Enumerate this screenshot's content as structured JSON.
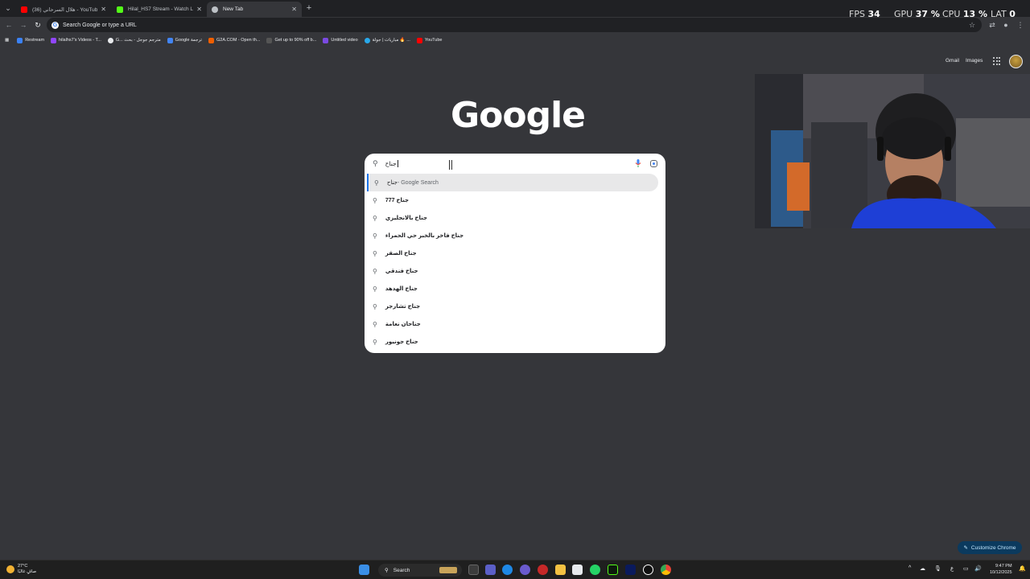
{
  "tabs": [
    {
      "title": "(36) هلال السرحاني - YouTube",
      "favicon_color": "#ff0000"
    },
    {
      "title": "Hilal_HS7 Stream - Watch Live",
      "favicon_color": "#53fc18"
    },
    {
      "title": "New Tab",
      "favicon_color": "#bdc1c6"
    }
  ],
  "overlay": {
    "fps_label": "FPS",
    "fps": "34",
    "gpu_label": "GPU",
    "gpu": "37 %",
    "cpu_label": "CPU",
    "cpu": "13 %",
    "lat_label": "LAT",
    "lat": "0 ms"
  },
  "omnibox": {
    "placeholder": "Search Google or type a URL"
  },
  "bookmarks": [
    {
      "label": "Restream",
      "color": "#3b82f6"
    },
    {
      "label": "hilalhs7's Videos - T...",
      "color": "#9146ff"
    },
    {
      "label": "G... مترجم جوجل - بحث",
      "color": "#e8eaed"
    },
    {
      "label": "Google ترجمة",
      "color": "#4285f4"
    },
    {
      "label": "G2A.COM - Open th...",
      "color": "#f05f00"
    },
    {
      "label": "Get up to 90% off b...",
      "color": "#2a2a2a"
    },
    {
      "label": "Untitled video",
      "color": "#7b4ae2"
    },
    {
      "label": "مباريات | جولة 🔥 ...",
      "color": "#29a9eb"
    },
    {
      "label": "YouTube",
      "color": "#ff0000"
    }
  ],
  "top_links": {
    "gmail": "Gmail",
    "images": "Images"
  },
  "logo_text": "Google",
  "search": {
    "query": "جناح",
    "suggestions": [
      {
        "bold": "جناح",
        "suffix": " - Google Search"
      },
      {
        "bold": "جناح 777",
        "suffix": ""
      },
      {
        "bold": "جناح بالانجليزي",
        "suffix": ""
      },
      {
        "bold": "جناح فاخر بالخبر حي الحمراء",
        "suffix": ""
      },
      {
        "bold": "جناح الصقر",
        "suffix": ""
      },
      {
        "bold": "جناح فندقي",
        "suffix": ""
      },
      {
        "bold": "جناح الهدهد",
        "suffix": ""
      },
      {
        "bold": "جناح تشارجر",
        "suffix": ""
      },
      {
        "bold": "جناحان نعامة",
        "suffix": ""
      },
      {
        "bold": "جناح جونيور",
        "suffix": ""
      }
    ]
  },
  "customize_label": "Customize Chrome",
  "taskbar": {
    "weather_temp": "27°C",
    "weather_desc": "صافٍ غالبًا",
    "search_label": "Search",
    "lang": "ع",
    "time": "9:47 PM",
    "date": "10/12/2025"
  }
}
